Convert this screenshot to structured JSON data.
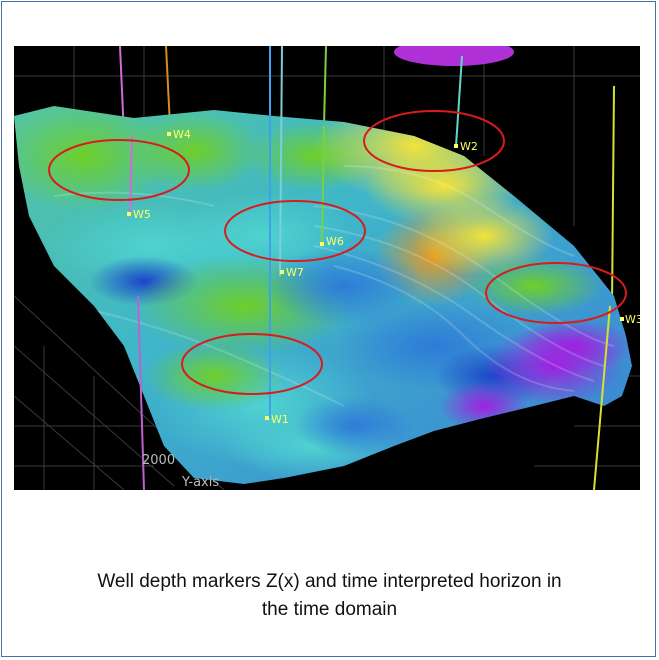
{
  "figure": {
    "wells": [
      {
        "id": "w4",
        "label": "W4"
      },
      {
        "id": "w2",
        "label": "W2"
      },
      {
        "id": "w5",
        "label": "W5"
      },
      {
        "id": "w6",
        "label": "W6"
      },
      {
        "id": "w7",
        "label": "W7"
      },
      {
        "id": "w3",
        "label": "W3"
      },
      {
        "id": "w1",
        "label": "W1"
      }
    ],
    "axis": {
      "tick_label": "2000",
      "axis_label": "Y-axis"
    },
    "highlight_color": "#d81c1c"
  },
  "caption": {
    "line1": "Well depth markers Z(x) and time interpreted horizon in",
    "line2": "the time domain"
  }
}
